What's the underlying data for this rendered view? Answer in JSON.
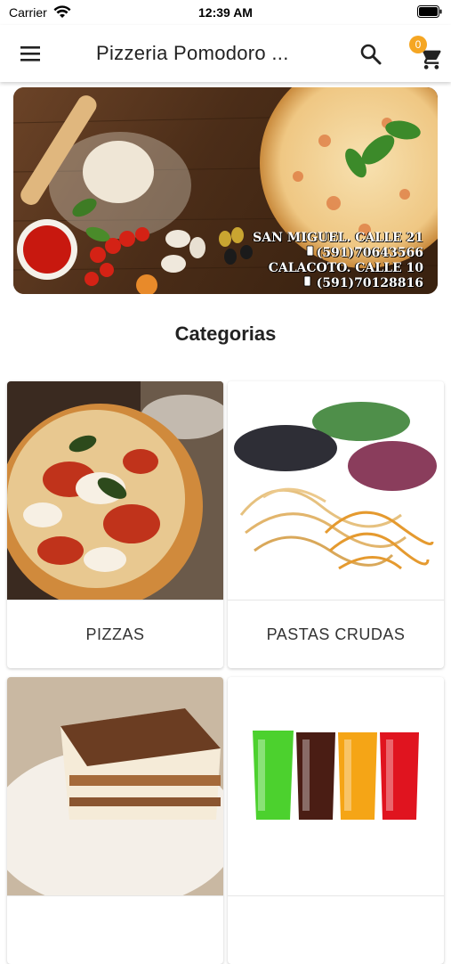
{
  "status": {
    "carrier": "Carrier",
    "time": "12:39 AM"
  },
  "appbar": {
    "title": "Pizzeria Pomodoro ...",
    "cart_count": "0"
  },
  "banner": {
    "line1": "SAN MIGUEL. CALLE 21",
    "line2": "(591)70643566",
    "line3": "CALACOTO. CALLE 10",
    "line4": "(591)70128816"
  },
  "categories": {
    "title": "Categorias",
    "items": [
      {
        "label": "PIZZAS"
      },
      {
        "label": "PASTAS CRUDAS"
      },
      {
        "label": ""
      },
      {
        "label": ""
      }
    ]
  },
  "colors": {
    "accent": "#f5a623",
    "text": "#222222"
  }
}
